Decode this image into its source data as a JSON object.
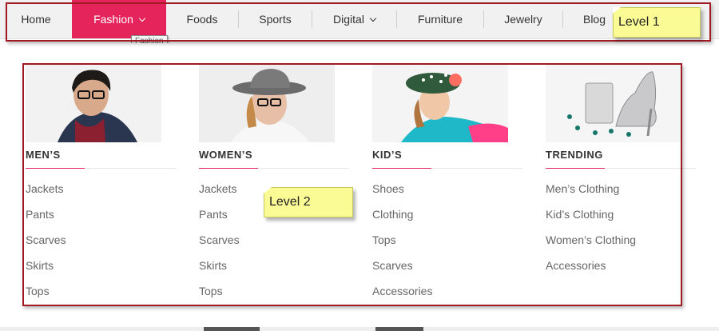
{
  "nav": {
    "items": [
      {
        "label": "Home"
      },
      {
        "label": "Fashion"
      },
      {
        "label": "Foods"
      },
      {
        "label": "Sports"
      },
      {
        "label": "Digital"
      },
      {
        "label": "Furniture"
      },
      {
        "label": "Jewelry"
      },
      {
        "label": "Blog"
      }
    ],
    "active": "Fashion",
    "tooltip": "Fashion",
    "accent_color": "#e4245b"
  },
  "annotations": {
    "level1": "Level 1",
    "level2": "Level 2",
    "frame_color": "#a11a22",
    "note_color": "#fbfb96"
  },
  "menu": {
    "columns": [
      {
        "title": "MEN’S",
        "image": "man-in-glasses-and-scarf",
        "links": [
          "Jackets",
          "Pants",
          "Scarves",
          "Skirts",
          "Tops"
        ]
      },
      {
        "title": "WOMEN’S",
        "image": "woman-in-hat-and-glasses",
        "links": [
          "Jackets",
          "Pants",
          "Scarves",
          "Skirts",
          "Tops"
        ]
      },
      {
        "title": "KID’S",
        "image": "girl-in-polka-dot-hat",
        "links": [
          "Shoes",
          "Clothing",
          "Tops",
          "Scarves",
          "Accessories"
        ]
      },
      {
        "title": "TRENDING",
        "image": "silver-heels-and-jewelry",
        "links": [
          "Men’s Clothing",
          "Kid’s Clothing",
          "Women’s Clothing",
          "Accessories"
        ]
      }
    ]
  }
}
